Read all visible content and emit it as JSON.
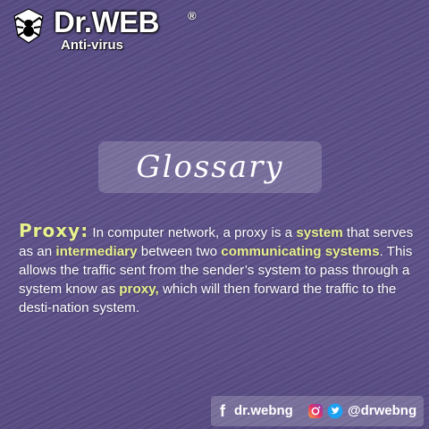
{
  "brand": {
    "name": "Dr.WEB",
    "registered_mark": "®",
    "subtitle": "Anti-virus",
    "logo_icon": "spider-icon"
  },
  "glossary": {
    "title": "Glossary"
  },
  "definition": {
    "term": "Proxy:",
    "segments": [
      {
        "text": " In computer network, a proxy is a ",
        "highlight": false
      },
      {
        "text": "system",
        "highlight": true
      },
      {
        "text": " that serves as an ",
        "highlight": false
      },
      {
        "text": "intermediary",
        "highlight": true
      },
      {
        "text": " between two ",
        "highlight": false
      },
      {
        "text": "communicating systems",
        "highlight": true
      },
      {
        "text": ". This allows the traffic sent from the sender’s system to pass through a system know as ",
        "highlight": false
      },
      {
        "text": "proxy,",
        "highlight": true
      },
      {
        "text": " which will then forward the traffic to the desti-nation system.",
        "highlight": false
      }
    ]
  },
  "social": {
    "facebook_icon": "facebook-icon",
    "facebook_handle": "dr.webng",
    "instagram_icon": "instagram-icon",
    "twitter_icon": "twitter-icon",
    "twitter_handle": "@drwebng"
  },
  "colors": {
    "background": "#5a4e86",
    "highlight": "#e8f18e",
    "text": "#ffffff",
    "twitter": "#1da1f2"
  }
}
